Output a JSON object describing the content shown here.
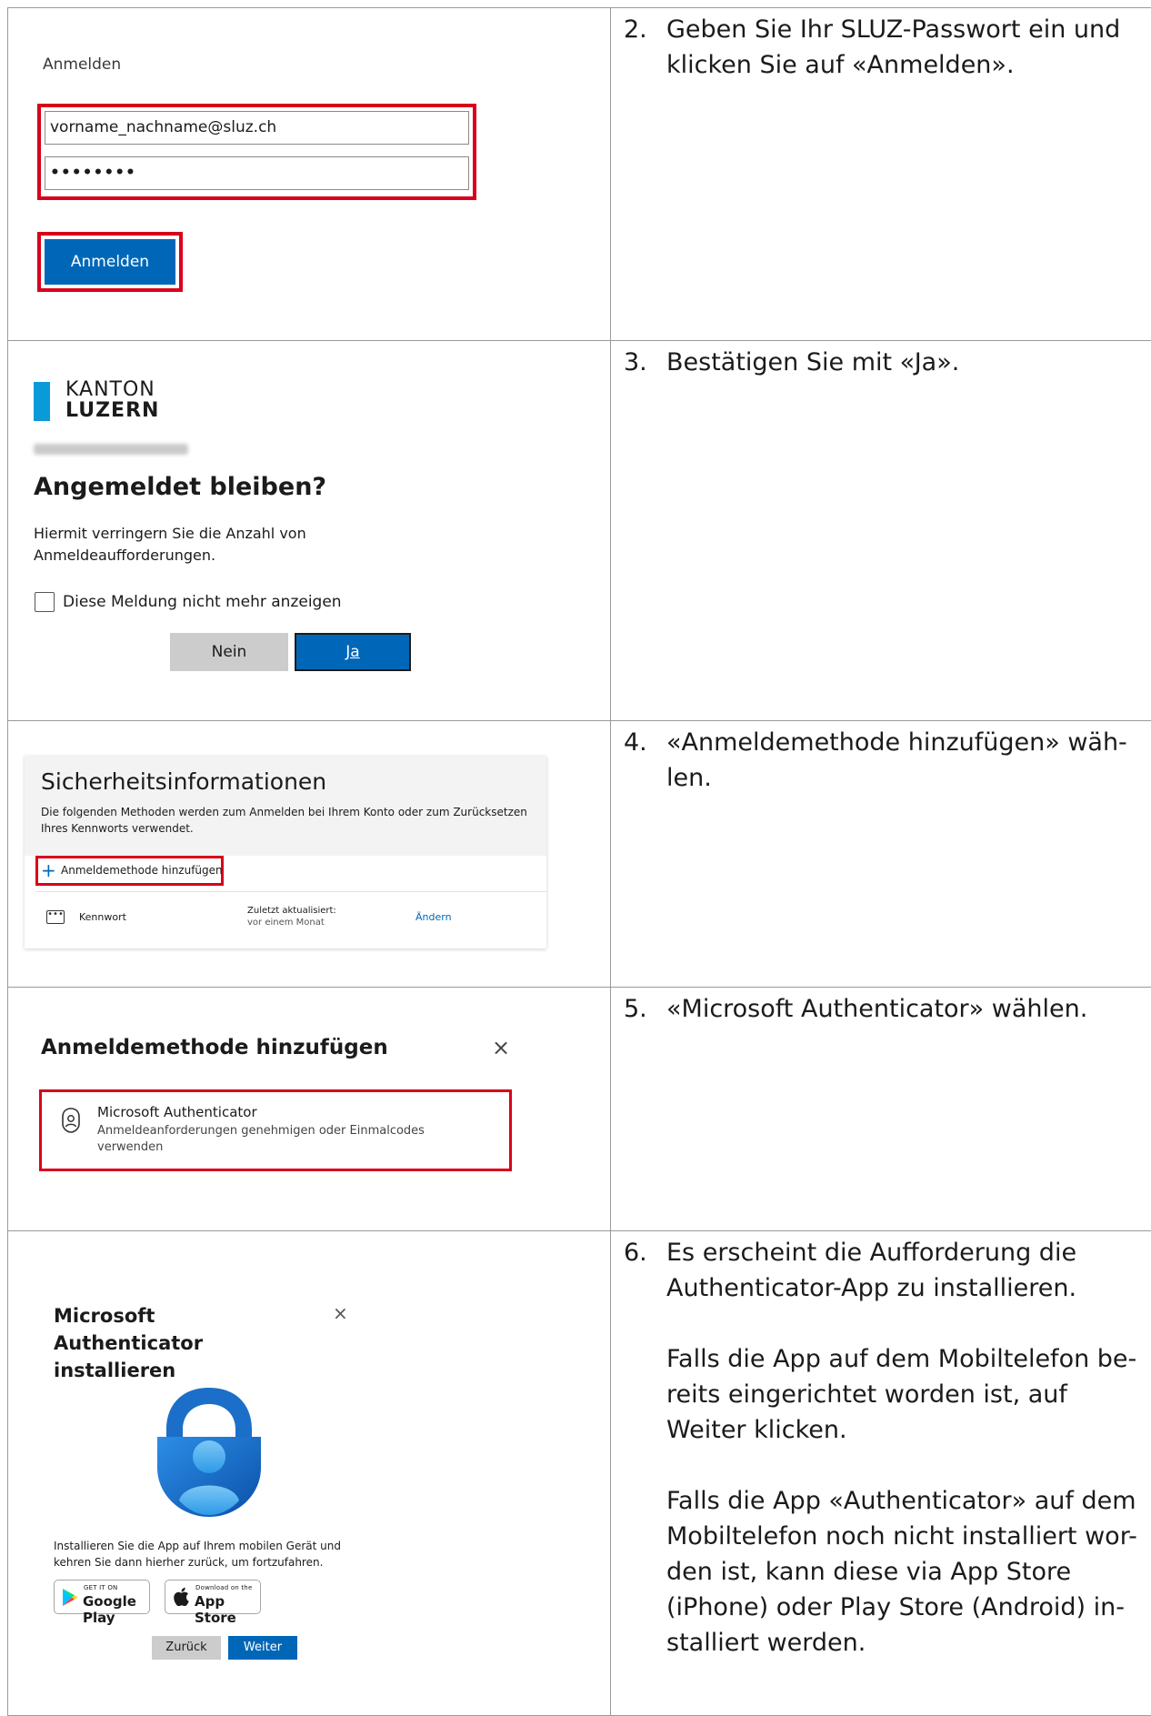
{
  "steps": [
    {
      "number": "2.",
      "paragraphs": [
        "Geben Sie Ihr SLUZ-Passwort ein und klicken Sie auf «Anmelden»."
      ],
      "panel": {
        "title": "Anmelden",
        "email_value": "vorname_nachname@sluz.ch",
        "password_value": "••••••••",
        "button_label": "Anmelden"
      }
    },
    {
      "number": "3.",
      "paragraphs": [
        "Bestätigen Sie mit «Ja»."
      ],
      "panel": {
        "logo_line1": "KANTON",
        "logo_line2": "LUZERN",
        "heading": "Angemeldet bleiben?",
        "description": "Hiermit verringern Sie die Anzahl von Anmeldeaufforderungen.",
        "checkbox_label": "Diese Meldung nicht mehr anzeigen",
        "no_label": "Nein",
        "yes_label": "Ja"
      }
    },
    {
      "number": "4.",
      "paragraphs": [
        "«Anmeldemethode hinzufügen» wäh-len."
      ],
      "panel": {
        "title": "Sicherheitsinformationen",
        "description": "Die folgenden Methoden werden zum Anmelden bei Ihrem Konto oder zum Zurücksetzen Ihres Kennworts verwendet.",
        "add_label": "Anmeldemethode hinzufügen",
        "method_name": "Kennwort",
        "updated_label": "Zuletzt aktualisiert:",
        "updated_value": "vor einem Monat",
        "change_label": "Ändern"
      }
    },
    {
      "number": "5.",
      "paragraphs": [
        "«Microsoft Authenticator» wählen."
      ],
      "panel": {
        "title": "Anmeldemethode hinzufügen",
        "close": "×",
        "option_name": "Microsoft Authenticator",
        "option_desc": "Anmeldeanforderungen genehmigen oder Einmalcodes verwenden"
      }
    },
    {
      "number": "6.",
      "paragraphs": [
        "Es erscheint die Aufforderung die Authenticator-App zu installieren.",
        "Falls die App auf dem Mobiltelefon be-reits eingerichtet worden ist, auf Weiter klicken.",
        "Falls die App «Authenticator» auf dem Mobiltelefon noch nicht installiert wor-den ist, kann diese via App Store (iPhone) oder Play Store (Android) in-stalliert werden."
      ],
      "panel": {
        "title": "Microsoft Authenticator installieren",
        "close": "×",
        "description": "Installieren Sie die App auf Ihrem mobilen Gerät und kehren Sie dann hierher zurück, um fortzufahren.",
        "google_small": "GET IT ON",
        "google_big": "Google Play",
        "apple_small": "Download on the",
        "apple_big": "App Store",
        "back_label": "Zurück",
        "next_label": "Weiter"
      }
    }
  ],
  "colors": {
    "accent_blue": "#0067b8",
    "highlight_red": "#d9001b",
    "kanton_blue": "#0a9ad9"
  }
}
